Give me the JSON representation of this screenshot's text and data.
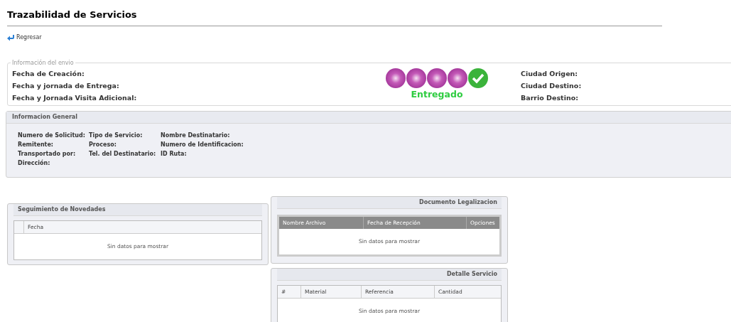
{
  "title": "Trazabilidad de Servicios",
  "back_link": "Regresar",
  "shipment_info": {
    "legend": "Información del envio",
    "left_labels": [
      "Fecha de Creación:",
      "Fecha y jornada de Entrega:",
      "Fecha y Jornada Visita Adicional:"
    ],
    "steps": [
      {
        "kind": "pending"
      },
      {
        "kind": "pending"
      },
      {
        "kind": "pending"
      },
      {
        "kind": "pending"
      },
      {
        "kind": "complete"
      }
    ],
    "status": "Entregado",
    "right_labels": [
      "Ciudad Origen:",
      "Ciudad Destino:",
      "Barrio Destino:"
    ]
  },
  "general_info": {
    "title": "Informacion General",
    "columns": [
      [
        "Numero de Solicitud:",
        "Remitente:",
        "Transportado por:",
        "Dirección:"
      ],
      [
        "Tipo de Servicio:",
        "Proceso:",
        "Tel. del Destinatario:"
      ],
      [
        "Nombre Destinatario:",
        "Numero de Identificacion:",
        "ID Ruta:"
      ]
    ]
  },
  "tracking": {
    "title": "Seguimiento de Novedades",
    "columns": [
      "",
      "Fecha"
    ],
    "empty": "Sin datos para mostrar"
  },
  "legalization": {
    "title": "Documento Legalizacion",
    "columns": [
      "Nombre Archivo",
      "Fecha de Recepción",
      "Opciones"
    ],
    "empty": "Sin datos para mostrar"
  },
  "service_detail": {
    "title": "Detalle Servicio",
    "columns": [
      "#",
      "Material",
      "Referencia",
      "Cantidad"
    ],
    "empty": "Sin datos para mostrar"
  }
}
